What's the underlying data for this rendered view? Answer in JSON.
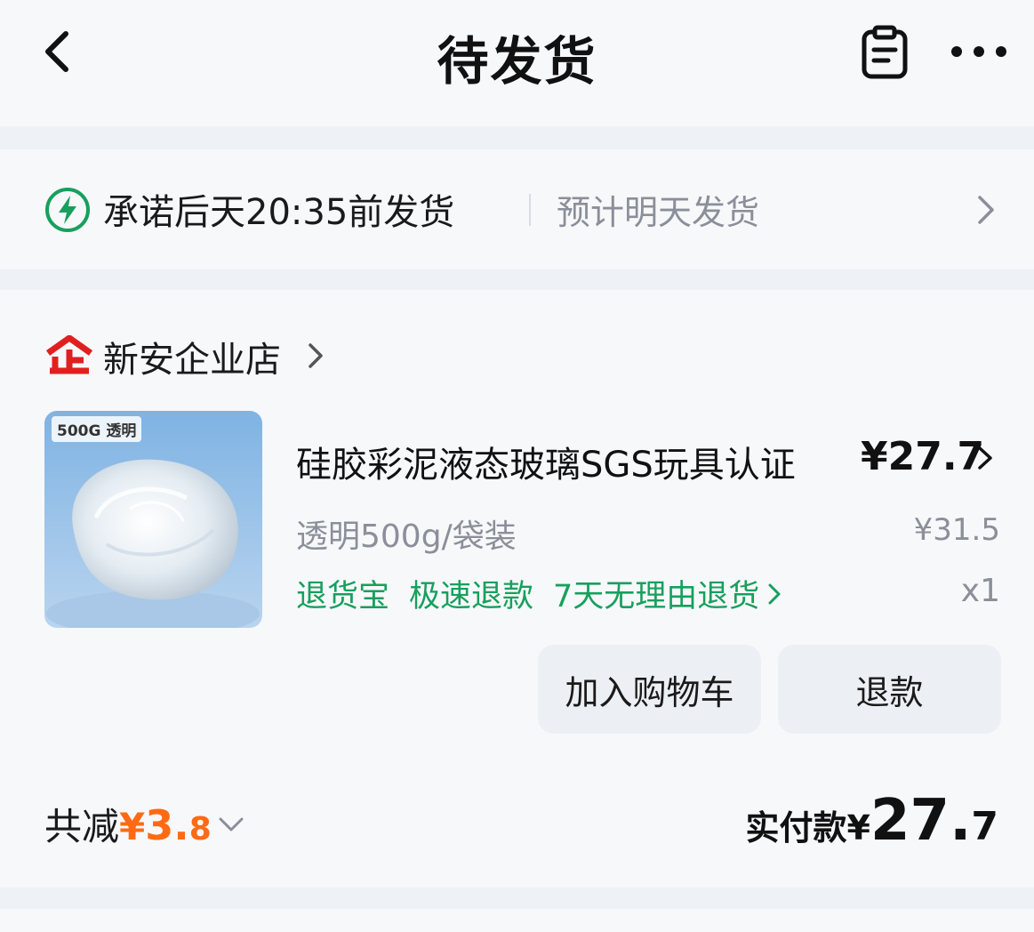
{
  "header": {
    "title": "待发货",
    "back_icon": "chevron-left-icon",
    "clipboard_icon": "clipboard-icon",
    "more_icon": "more-horizontal-icon"
  },
  "shipping": {
    "promise": "承诺后天20:35前发货",
    "estimate": "预计明天发货",
    "icon": "lightning-bolt-icon",
    "accent_color": "#17a05d"
  },
  "shop": {
    "name": "新安企业店",
    "logo_text": "企",
    "logo_color": "#e02020"
  },
  "product": {
    "image_tag": "500G 透明",
    "title": "硅胶彩泥液态玻璃SGS玩具认证",
    "price": "¥27.7",
    "spec": "透明500g/袋装",
    "original_price": "¥31.5",
    "quantity": "x1",
    "service_tags": [
      "退货宝",
      "极速退款",
      "7天无理由退货"
    ],
    "service_color": "#17a05d"
  },
  "actions": {
    "add_to_cart": "加入购物车",
    "refund": "退款"
  },
  "summary": {
    "discount_label": "共减",
    "discount_currency": "¥",
    "discount_int": "3.",
    "discount_dec": "8",
    "discount_color": "#ff6a14",
    "paid_label": "实付款",
    "paid_currency": "¥",
    "paid_int": "27.",
    "paid_dec": "7"
  }
}
